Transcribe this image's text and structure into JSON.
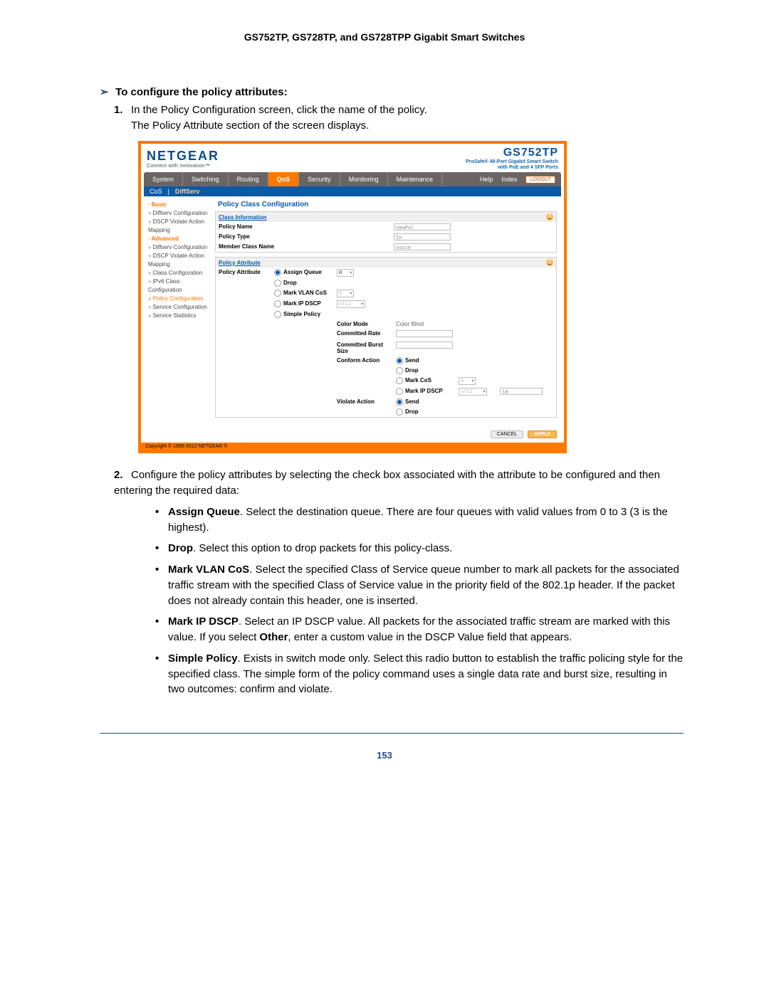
{
  "page": {
    "doctitle": "GS752TP, GS728TP, and GS728TPP Gigabit Smart Switches",
    "pagenum": "153"
  },
  "task": {
    "arrow": "➢",
    "title": "To configure the policy attributes:"
  },
  "steps": {
    "s1": {
      "num": "1.",
      "line1": "In the Policy Configuration screen, click the name of the policy.",
      "line2": "The Policy Attribute section of the screen displays."
    },
    "s2": {
      "num": "2.",
      "text": "Configure the policy attributes by selecting the check box associated with the attribute to be configured and then entering the required data:"
    }
  },
  "bullets": {
    "b1": {
      "bold": "Assign Queue",
      "text": ". Select the destination queue. There are four queues with valid values from 0 to 3 (3 is the highest)."
    },
    "b2": {
      "bold": "Drop",
      "text": ". Select this option to drop packets for this policy-class."
    },
    "b3": {
      "bold": "Mark VLAN CoS",
      "text": ". Select the specified Class of Service queue number to mark all packets for the associated traffic stream with the specified Class of Service value in the priority field of the 802.1p header. If the packet does not already contain this header, one is inserted."
    },
    "b4": {
      "bold": "Mark IP DSCP",
      "text1": ". Select an IP DSCP value. All packets for the associated traffic stream are marked with this value. If you select ",
      "bold2": "Other",
      "text2": ", enter a custom value in the DSCP Value field that appears."
    },
    "b5": {
      "bold": "Simple Policy",
      "text": ". Exists in switch mode only. Select this radio button to establish the traffic policing style for the specified class. The simple form of the policy command uses a single data rate and burst size, resulting in two outcomes: confirm and violate."
    }
  },
  "ui": {
    "brand": {
      "logo": "NETGEAR",
      "tag": "Connect with Innovation™"
    },
    "product": {
      "model": "GS752TP",
      "desc1": "ProSafe® 48-Port Gigabit Smart Switch",
      "desc2": "with PoE and 4 SFP Ports"
    },
    "nav": {
      "system": "System",
      "switching": "Switching",
      "routing": "Routing",
      "qos": "QoS",
      "security": "Security",
      "monitoring": "Monitoring",
      "maintenance": "Maintenance",
      "help": "Help",
      "index": "Index",
      "logout": "LOGOUT"
    },
    "subnav": {
      "cos": "CoS",
      "sep": "|",
      "diffserv": "DiffServ"
    },
    "sidebar": {
      "basic": "Basic",
      "diffserv_cfg": "Diffserv Configuration",
      "dscp_violate": "DSCP Violate Action Mapping",
      "advanced": "Advanced",
      "class_cfg": "Class Configuration",
      "ipv6_class_cfg": "IPv6 Class Configuration",
      "policy_cfg": "Policy Configuration",
      "service_cfg": "Service Configuration",
      "service_stats": "Service Statistics"
    },
    "main": {
      "title": "Policy Class Configuration",
      "class_info_hdr": "Class Information",
      "policy_name_k": "Policy Name",
      "policy_name_v": "newPol",
      "policy_type_k": "Policy Type",
      "policy_type_v": "In",
      "member_class_k": "Member Class Name",
      "member_class_v": "voice",
      "policy_attr_hdr": "Policy Attribute",
      "pa_k": "Policy Attribute",
      "assign_queue": "Assign Queue",
      "assign_queue_v": "0",
      "drop": "Drop",
      "mark_vlan_cos": "Mark VLAN CoS",
      "mark_vlan_cos_v": "0",
      "mark_ip_dscp": "Mark IP DSCP",
      "mark_ip_dscp_v": "af11",
      "simple_policy": "Simple Policy",
      "color_mode": "Color Mode",
      "color_blind": "Color Blind",
      "committed_rate": "Committed Rate",
      "committed_burst": "Committed Burst Size",
      "conform_action": "Conform Action",
      "send": "Send",
      "drop2": "Drop",
      "mark_cos": "Mark CoS",
      "mark_cos_v": "0",
      "mark_ip_dscp_conf": "Mark IP DSCP",
      "mark_ip_dscp_conf_v": "af11",
      "mark_ip_dscp_conf_in": "10",
      "violate_action": "Violate Action"
    },
    "btns": {
      "cancel": "CANCEL",
      "apply": "APPLY"
    },
    "copyright": "Copyright © 1996-2012 NETGEAR ®"
  }
}
